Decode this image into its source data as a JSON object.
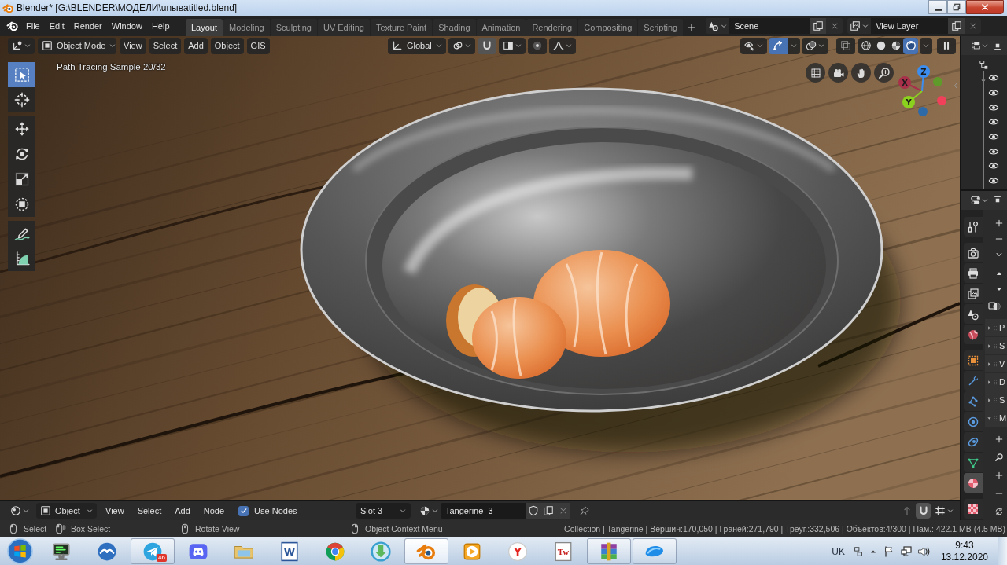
{
  "window": {
    "title": "Blender* [G:\\BLENDER\\МОДЕЛИ\\unывatitled.blend]"
  },
  "menu": [
    "File",
    "Edit",
    "Render",
    "Window",
    "Help"
  ],
  "workspaces": [
    {
      "label": "Layout",
      "selected": true
    },
    {
      "label": "Modeling",
      "selected": false
    },
    {
      "label": "Sculpting",
      "selected": false
    },
    {
      "label": "UV Editing",
      "selected": false
    },
    {
      "label": "Texture Paint",
      "selected": false
    },
    {
      "label": "Shading",
      "selected": false
    },
    {
      "label": "Animation",
      "selected": false
    },
    {
      "label": "Rendering",
      "selected": false
    },
    {
      "label": "Compositing",
      "selected": false
    },
    {
      "label": "Scripting",
      "selected": false
    }
  ],
  "scene": "Scene",
  "view_layer": "View Layer",
  "viewport": {
    "mode": "Object Mode",
    "menus": [
      "View",
      "Select",
      "Add",
      "Object",
      "GIS"
    ],
    "orientation": "Global",
    "show_gizmos": true,
    "shading": [
      {
        "kind": "wireframe",
        "selected": false
      },
      {
        "kind": "solid",
        "selected": false
      },
      {
        "kind": "material",
        "selected": false
      },
      {
        "kind": "rendered",
        "selected": true
      }
    ],
    "tools": [
      {
        "kind": "select-box",
        "selected": true
      },
      {
        "kind": "cursor",
        "selected": false
      },
      {
        "kind": "move",
        "selected": false
      },
      {
        "kind": "rotate",
        "selected": false
      },
      {
        "kind": "scale",
        "selected": false
      },
      {
        "kind": "transform",
        "selected": false
      },
      {
        "kind": "annotate",
        "selected": false
      },
      {
        "kind": "measure",
        "selected": false
      }
    ],
    "render_info": "Path Tracing Sample 20/32",
    "axes": [
      {
        "label": "X",
        "color": "#a8304a"
      },
      {
        "label": "Z",
        "color": "#3b8ef0"
      },
      {
        "label": "Y",
        "color": "#8bd21e"
      },
      {
        "color": "#5f9a2a"
      },
      {
        "color": "#f0405a"
      },
      {
        "color": "#2e6aa8"
      }
    ]
  },
  "outliner": {
    "expanded": true,
    "rows": [
      {
        "visible": true
      },
      {
        "visible": true
      },
      {
        "visible": true
      },
      {
        "visible": true
      },
      {
        "visible": true
      },
      {
        "visible": true
      },
      {
        "visible": true
      },
      {
        "visible": true
      }
    ]
  },
  "properties": {
    "tabs": [
      {
        "kind": "tool",
        "selected": false
      },
      {
        "kind": "render",
        "selected": false
      },
      {
        "kind": "output",
        "selected": false
      },
      {
        "kind": "view_layer",
        "selected": false
      },
      {
        "kind": "scene",
        "selected": false
      },
      {
        "kind": "world",
        "selected": false
      },
      {
        "kind": "object",
        "selected": false
      },
      {
        "kind": "modifiers",
        "selected": false
      },
      {
        "kind": "particles",
        "selected": false
      },
      {
        "kind": "physics",
        "selected": false
      },
      {
        "kind": "constraints",
        "selected": false
      },
      {
        "kind": "data",
        "selected": false
      },
      {
        "kind": "material",
        "selected": true
      },
      {
        "kind": "texture",
        "selected": false
      }
    ],
    "panels": [
      {
        "label": "P",
        "expanded": false
      },
      {
        "label": "S",
        "expanded": false
      },
      {
        "label": "V",
        "expanded": false
      },
      {
        "label": "D",
        "expanded": false
      },
      {
        "label": "S",
        "expanded": false
      },
      {
        "label": "M",
        "expanded": true
      }
    ]
  },
  "node_editor": {
    "object_type": "Object",
    "menus": [
      "View",
      "Select",
      "Add",
      "Node"
    ],
    "use_nodes": {
      "label": "Use Nodes",
      "checked": true
    },
    "slot": "Slot 3",
    "material": "Tangerine_3"
  },
  "status_bar": {
    "hints": [
      {
        "kind": "left",
        "label": "Select"
      },
      {
        "kind": "drag",
        "label": "Box Select"
      },
      {
        "kind": "middle",
        "label": "Rotate View"
      },
      {
        "kind": "right",
        "label": "Object Context Menu"
      }
    ],
    "stats": "Collection | Tangerine | Вершин:170,050 | Граней:271,790 | Треуг.:332,506 | Объектов:4/300 | Пам.: 422.1 MB (4.5 MB)"
  },
  "taskbar": {
    "apps": [
      {
        "kind": "computer",
        "running": false,
        "selected": false
      },
      {
        "kind": "gull",
        "running": false,
        "selected": false
      },
      {
        "kind": "plane",
        "running": true,
        "selected": false,
        "badge": "46"
      },
      {
        "kind": "controller",
        "running": false,
        "selected": false
      },
      {
        "kind": "folder",
        "running": false,
        "selected": false
      },
      {
        "kind": "document",
        "running": false,
        "selected": false,
        "glyph": "W"
      },
      {
        "kind": "browser",
        "running": false,
        "selected": false
      },
      {
        "kind": "download",
        "running": false,
        "selected": false
      },
      {
        "kind": "blender",
        "running": true,
        "selected": true
      },
      {
        "kind": "player",
        "running": false,
        "selected": false
      },
      {
        "kind": "letter",
        "running": false,
        "selected": false,
        "glyph": "Y"
      },
      {
        "kind": "text-doc",
        "running": false,
        "selected": false,
        "glyph": "Tw"
      },
      {
        "kind": "archive",
        "running": true,
        "selected": false
      },
      {
        "kind": "disk",
        "running": true,
        "selected": false
      }
    ],
    "tray": {
      "language": "UK",
      "time": "9:43",
      "date": "13.12.2020"
    }
  }
}
